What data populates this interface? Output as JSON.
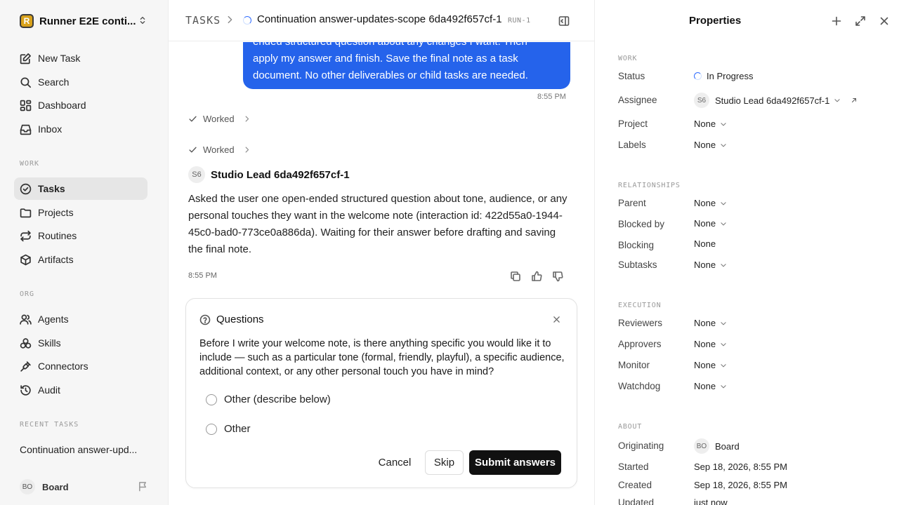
{
  "workspace": {
    "logo_letter": "R",
    "name": "Runner E2E conti..."
  },
  "sidebar": {
    "top_items": [
      {
        "label": "New Task",
        "icon": "edit-icon"
      },
      {
        "label": "Search",
        "icon": "search-icon"
      },
      {
        "label": "Dashboard",
        "icon": "dashboard-icon"
      },
      {
        "label": "Inbox",
        "icon": "inbox-icon"
      }
    ],
    "work_label": "WORK",
    "work_items": [
      {
        "label": "Tasks",
        "icon": "check-circle-icon",
        "active": true
      },
      {
        "label": "Projects",
        "icon": "folder-icon"
      },
      {
        "label": "Routines",
        "icon": "repeat-icon"
      },
      {
        "label": "Artifacts",
        "icon": "box-icon"
      }
    ],
    "org_label": "ORG",
    "org_items": [
      {
        "label": "Agents",
        "icon": "users-icon"
      },
      {
        "label": "Skills",
        "icon": "skills-icon"
      },
      {
        "label": "Connectors",
        "icon": "plug-icon"
      },
      {
        "label": "Audit",
        "icon": "history-icon"
      }
    ],
    "recent_label": "RECENT TASKS",
    "recent_item": "Continuation answer-upd...",
    "user": {
      "initials": "BO",
      "name": "Board"
    }
  },
  "header": {
    "root": "TASKS",
    "title": "Continuation answer-updates-scope 6da492f657cf-1",
    "run_badge": "RUN-1"
  },
  "chat": {
    "user_bubble_lines": [
      "ended structured question about any changes I want. Then",
      "apply my answer and finish. Save the final note as a task",
      "document. No other deliverables or child tasks are needed."
    ],
    "user_time": "8:55 PM",
    "worked_label_1": "Worked",
    "worked_label_2": "Worked",
    "agent": {
      "initials": "S6",
      "name": "Studio Lead 6da492f657cf-1"
    },
    "agent_message": "Asked the user one open-ended structured question about tone, audience, or any personal touches they want in the welcome note (interaction id: 422d55a0-1944-45c0-bad0-773ce0a886da). Waiting for their answer before drafting and saving the final note.",
    "agent_time": "8:55 PM"
  },
  "questions": {
    "title": "Questions",
    "text": "Before I write your welcome note, is there anything specific you would like it to include — such as a particular tone (formal, friendly, playful), a specific audience, additional context, or any other personal touch you have in mind?",
    "options": [
      "Other (describe below)",
      "Other"
    ],
    "cancel_label": "Cancel",
    "skip_label": "Skip",
    "submit_label": "Submit answers"
  },
  "properties": {
    "title": "Properties",
    "work_label": "WORK",
    "status_label": "Status",
    "status_value": "In Progress",
    "assignee_label": "Assignee",
    "assignee_initials": "S6",
    "assignee_value": "Studio Lead 6da492f657cf-1",
    "project_label": "Project",
    "project_value": "None",
    "labels_label": "Labels",
    "labels_value": "None",
    "relationships_label": "RELATIONSHIPS",
    "parent_label": "Parent",
    "parent_value": "None",
    "blocked_by_label": "Blocked by",
    "blocked_by_value": "None",
    "blocking_label": "Blocking",
    "blocking_value": "None",
    "subtasks_label": "Subtasks",
    "subtasks_value": "None",
    "execution_label": "EXECUTION",
    "reviewers_label": "Reviewers",
    "reviewers_value": "None",
    "approvers_label": "Approvers",
    "approvers_value": "None",
    "monitor_label": "Monitor",
    "monitor_value": "None",
    "watchdog_label": "Watchdog",
    "watchdog_value": "None",
    "about_label": "ABOUT",
    "originating_label": "Originating",
    "originating_initials": "BO",
    "originating_value": "Board",
    "started_label": "Started",
    "started_value": "Sep 18, 2026, 8:55 PM",
    "created_label": "Created",
    "created_value": "Sep 18, 2026, 8:55 PM",
    "updated_label": "Updated",
    "updated_value": "just now"
  },
  "colors": {
    "accent": "#2563eb",
    "spinner": "#2f6bff",
    "submit": "#111111",
    "active_nav": "#e6e6e6"
  }
}
